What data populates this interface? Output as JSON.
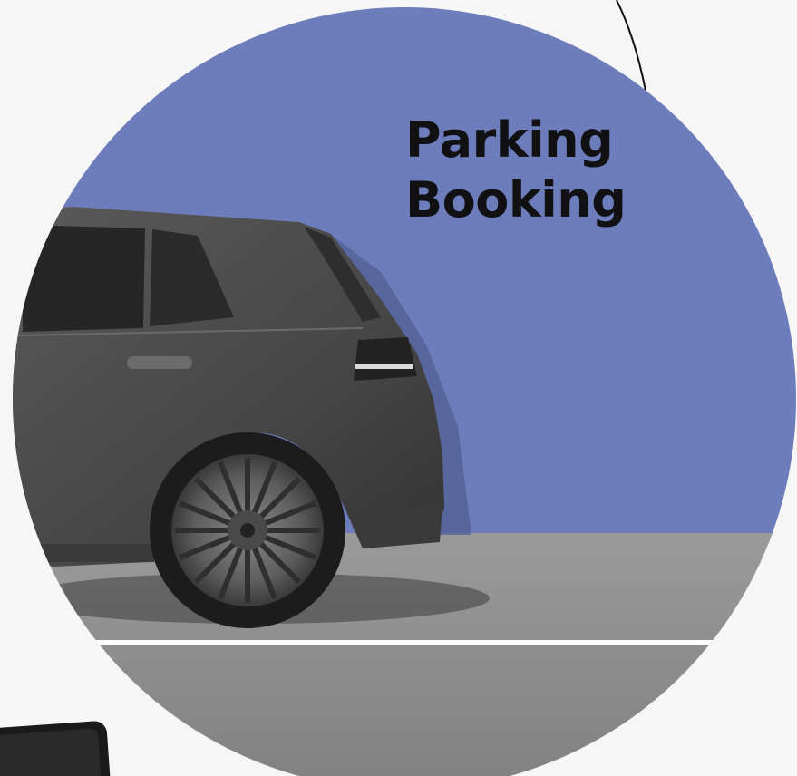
{
  "headline": {
    "line1": "Parking",
    "line2": "Booking"
  },
  "colors": {
    "page_background": "#f6f6f6",
    "circle_sky": "#6d7dbb",
    "asphalt": "#8c8c8c",
    "road_marking": "#ffffff",
    "car_body": "#4a4a4a",
    "headline_text": "#111114"
  },
  "icons": {
    "car": "car-photo",
    "phone": "phone-device"
  }
}
